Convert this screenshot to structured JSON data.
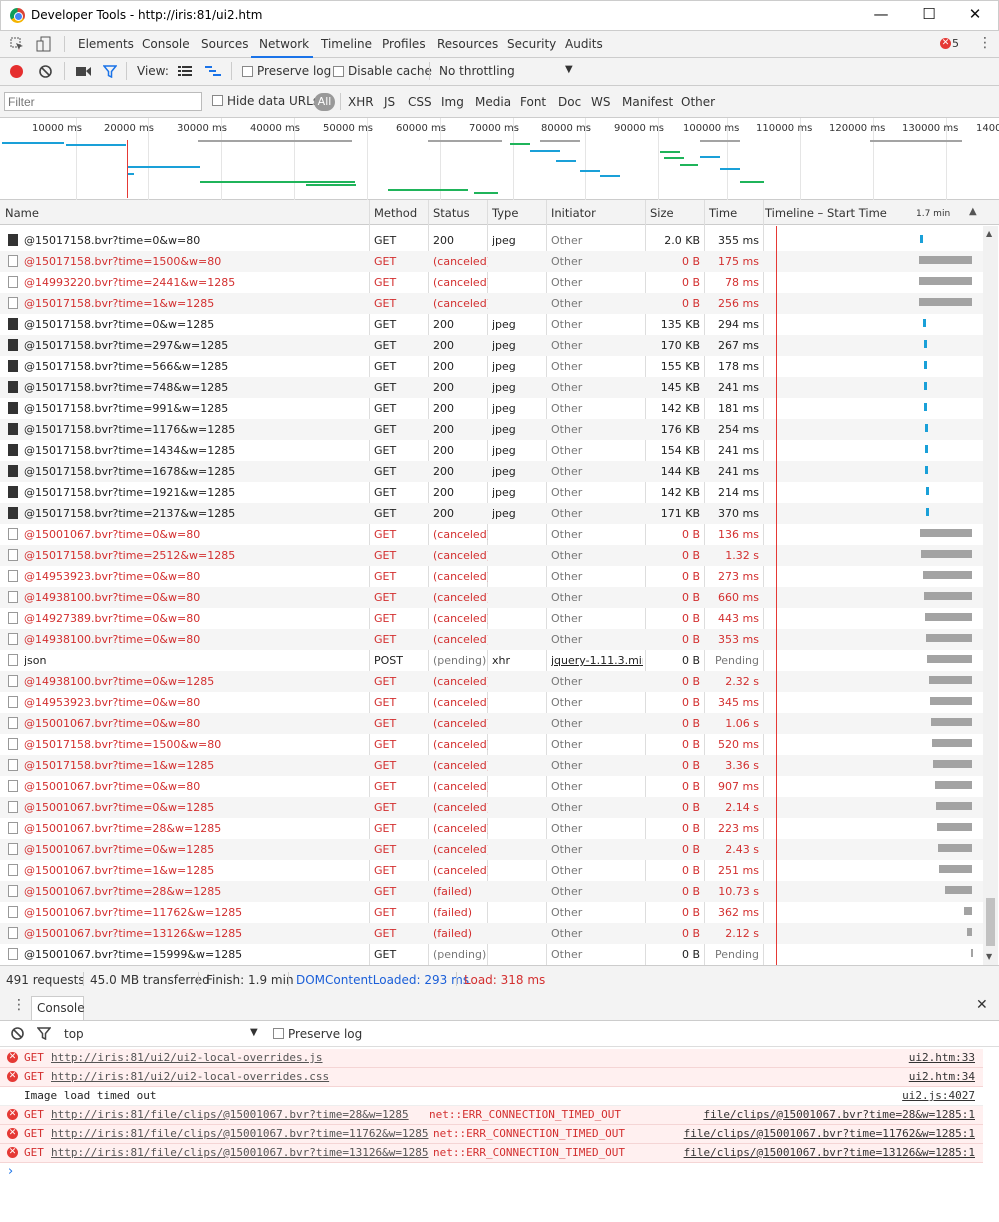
{
  "window": {
    "title": "Developer Tools - http://iris:81/ui2.htm",
    "min": "—",
    "max": "☐",
    "close": "✕"
  },
  "tabs": [
    "Elements",
    "Console",
    "Sources",
    "Network",
    "Timeline",
    "Profiles",
    "Resources",
    "Security",
    "Audits"
  ],
  "error_count": "5",
  "toolbar": {
    "view": "View:",
    "preserve_log": "Preserve log",
    "disable_cache": "Disable cache",
    "throttle": "No throttling"
  },
  "filter": {
    "placeholder": "Filter",
    "hide_data_urls": "Hide data URLs",
    "types": [
      "All",
      "XHR",
      "JS",
      "CSS",
      "Img",
      "Media",
      "Font",
      "Doc",
      "WS",
      "Manifest",
      "Other"
    ]
  },
  "overview": {
    "ticks": [
      "10000 ms",
      "20000 ms",
      "30000 ms",
      "40000 ms",
      "50000 ms",
      "60000 ms",
      "70000 ms",
      "80000 ms",
      "90000 ms",
      "100000 ms",
      "110000 ms",
      "120000 ms",
      "130000 ms",
      "1400"
    ]
  },
  "columns": {
    "name": "Name",
    "method": "Method",
    "status": "Status",
    "type": "Type",
    "initiator": "Initiator",
    "size": "Size",
    "time": "Time",
    "timeline": "Timeline – Start Time",
    "scale": "1.7 min"
  },
  "requests": [
    {
      "name": "@15017158.bvr?time=0&w=80",
      "method": "GET",
      "status": "200",
      "type": "jpeg",
      "initiator": "Other",
      "size": "2.0 KB",
      "time": "355 ms",
      "state": "ok"
    },
    {
      "name": "@15017158.bvr?time=1500&w=80",
      "method": "GET",
      "status": "(canceled)",
      "type": "",
      "initiator": "Other",
      "size": "0 B",
      "time": "175 ms",
      "state": "err"
    },
    {
      "name": "@14993220.bvr?time=2441&w=1285",
      "method": "GET",
      "status": "(canceled)",
      "type": "",
      "initiator": "Other",
      "size": "0 B",
      "time": "78 ms",
      "state": "err"
    },
    {
      "name": "@15017158.bvr?time=1&w=1285",
      "method": "GET",
      "status": "(canceled)",
      "type": "",
      "initiator": "Other",
      "size": "0 B",
      "time": "256 ms",
      "state": "err"
    },
    {
      "name": "@15017158.bvr?time=0&w=1285",
      "method": "GET",
      "status": "200",
      "type": "jpeg",
      "initiator": "Other",
      "size": "135 KB",
      "time": "294 ms",
      "state": "ok"
    },
    {
      "name": "@15017158.bvr?time=297&w=1285",
      "method": "GET",
      "status": "200",
      "type": "jpeg",
      "initiator": "Other",
      "size": "170 KB",
      "time": "267 ms",
      "state": "ok"
    },
    {
      "name": "@15017158.bvr?time=566&w=1285",
      "method": "GET",
      "status": "200",
      "type": "jpeg",
      "initiator": "Other",
      "size": "155 KB",
      "time": "178 ms",
      "state": "ok"
    },
    {
      "name": "@15017158.bvr?time=748&w=1285",
      "method": "GET",
      "status": "200",
      "type": "jpeg",
      "initiator": "Other",
      "size": "145 KB",
      "time": "241 ms",
      "state": "ok"
    },
    {
      "name": "@15017158.bvr?time=991&w=1285",
      "method": "GET",
      "status": "200",
      "type": "jpeg",
      "initiator": "Other",
      "size": "142 KB",
      "time": "181 ms",
      "state": "ok"
    },
    {
      "name": "@15017158.bvr?time=1176&w=1285",
      "method": "GET",
      "status": "200",
      "type": "jpeg",
      "initiator": "Other",
      "size": "176 KB",
      "time": "254 ms",
      "state": "ok"
    },
    {
      "name": "@15017158.bvr?time=1434&w=1285",
      "method": "GET",
      "status": "200",
      "type": "jpeg",
      "initiator": "Other",
      "size": "154 KB",
      "time": "241 ms",
      "state": "ok"
    },
    {
      "name": "@15017158.bvr?time=1678&w=1285",
      "method": "GET",
      "status": "200",
      "type": "jpeg",
      "initiator": "Other",
      "size": "144 KB",
      "time": "241 ms",
      "state": "ok"
    },
    {
      "name": "@15017158.bvr?time=1921&w=1285",
      "method": "GET",
      "status": "200",
      "type": "jpeg",
      "initiator": "Other",
      "size": "142 KB",
      "time": "214 ms",
      "state": "ok"
    },
    {
      "name": "@15017158.bvr?time=2137&w=1285",
      "method": "GET",
      "status": "200",
      "type": "jpeg",
      "initiator": "Other",
      "size": "171 KB",
      "time": "370 ms",
      "state": "ok"
    },
    {
      "name": "@15001067.bvr?time=0&w=80",
      "method": "GET",
      "status": "(canceled)",
      "type": "",
      "initiator": "Other",
      "size": "0 B",
      "time": "136 ms",
      "state": "err"
    },
    {
      "name": "@15017158.bvr?time=2512&w=1285",
      "method": "GET",
      "status": "(canceled)",
      "type": "",
      "initiator": "Other",
      "size": "0 B",
      "time": "1.32 s",
      "state": "err"
    },
    {
      "name": "@14953923.bvr?time=0&w=80",
      "method": "GET",
      "status": "(canceled)",
      "type": "",
      "initiator": "Other",
      "size": "0 B",
      "time": "273 ms",
      "state": "err"
    },
    {
      "name": "@14938100.bvr?time=0&w=80",
      "method": "GET",
      "status": "(canceled)",
      "type": "",
      "initiator": "Other",
      "size": "0 B",
      "time": "660 ms",
      "state": "err"
    },
    {
      "name": "@14927389.bvr?time=0&w=80",
      "method": "GET",
      "status": "(canceled)",
      "type": "",
      "initiator": "Other",
      "size": "0 B",
      "time": "443 ms",
      "state": "err"
    },
    {
      "name": "@14938100.bvr?time=0&w=80",
      "method": "GET",
      "status": "(canceled)",
      "type": "",
      "initiator": "Other",
      "size": "0 B",
      "time": "353 ms",
      "state": "err"
    },
    {
      "name": "json",
      "method": "POST",
      "status": "(pending)",
      "type": "xhr",
      "initiator": "jquery-1.11.3.min...",
      "size": "0 B",
      "time": "Pending",
      "state": "pending"
    },
    {
      "name": "@14938100.bvr?time=0&w=1285",
      "method": "GET",
      "status": "(canceled)",
      "type": "",
      "initiator": "Other",
      "size": "0 B",
      "time": "2.32 s",
      "state": "err"
    },
    {
      "name": "@14953923.bvr?time=0&w=80",
      "method": "GET",
      "status": "(canceled)",
      "type": "",
      "initiator": "Other",
      "size": "0 B",
      "time": "345 ms",
      "state": "err"
    },
    {
      "name": "@15001067.bvr?time=0&w=80",
      "method": "GET",
      "status": "(canceled)",
      "type": "",
      "initiator": "Other",
      "size": "0 B",
      "time": "1.06 s",
      "state": "err"
    },
    {
      "name": "@15017158.bvr?time=1500&w=80",
      "method": "GET",
      "status": "(canceled)",
      "type": "",
      "initiator": "Other",
      "size": "0 B",
      "time": "520 ms",
      "state": "err"
    },
    {
      "name": "@15017158.bvr?time=1&w=1285",
      "method": "GET",
      "status": "(canceled)",
      "type": "",
      "initiator": "Other",
      "size": "0 B",
      "time": "3.36 s",
      "state": "err"
    },
    {
      "name": "@15001067.bvr?time=0&w=80",
      "method": "GET",
      "status": "(canceled)",
      "type": "",
      "initiator": "Other",
      "size": "0 B",
      "time": "907 ms",
      "state": "err"
    },
    {
      "name": "@15001067.bvr?time=0&w=1285",
      "method": "GET",
      "status": "(canceled)",
      "type": "",
      "initiator": "Other",
      "size": "0 B",
      "time": "2.14 s",
      "state": "err"
    },
    {
      "name": "@15001067.bvr?time=28&w=1285",
      "method": "GET",
      "status": "(canceled)",
      "type": "",
      "initiator": "Other",
      "size": "0 B",
      "time": "223 ms",
      "state": "err"
    },
    {
      "name": "@15001067.bvr?time=0&w=1285",
      "method": "GET",
      "status": "(canceled)",
      "type": "",
      "initiator": "Other",
      "size": "0 B",
      "time": "2.43 s",
      "state": "err"
    },
    {
      "name": "@15001067.bvr?time=1&w=1285",
      "method": "GET",
      "status": "(canceled)",
      "type": "",
      "initiator": "Other",
      "size": "0 B",
      "time": "251 ms",
      "state": "err"
    },
    {
      "name": "@15001067.bvr?time=28&w=1285",
      "method": "GET",
      "status": "(failed)",
      "type": "",
      "initiator": "Other",
      "size": "0 B",
      "time": "10.73 s",
      "state": "err"
    },
    {
      "name": "@15001067.bvr?time=11762&w=1285",
      "method": "GET",
      "status": "(failed)",
      "type": "",
      "initiator": "Other",
      "size": "0 B",
      "time": "362 ms",
      "state": "err"
    },
    {
      "name": "@15001067.bvr?time=13126&w=1285",
      "method": "GET",
      "status": "(failed)",
      "type": "",
      "initiator": "Other",
      "size": "0 B",
      "time": "2.12 s",
      "state": "err"
    },
    {
      "name": "@15001067.bvr?time=15999&w=1285",
      "method": "GET",
      "status": "(pending)",
      "type": "",
      "initiator": "Other",
      "size": "0 B",
      "time": "Pending",
      "state": "pending"
    }
  ],
  "status_bar": {
    "requests": "491 requests",
    "transferred": "45.0 MB transferred",
    "finish": "Finish: 1.9 min",
    "dcl": "DOMContentLoaded: 293 ms",
    "load": "Load: 318 ms"
  },
  "drawer": {
    "tab": "Console",
    "context": "top",
    "preserve_log": "Preserve log"
  },
  "console": [
    {
      "kind": "err",
      "prefix": "GET",
      "url": "http://iris:81/ui2/ui2-local-overrides.js",
      "extra": "",
      "source": "ui2.htm:33"
    },
    {
      "kind": "err",
      "prefix": "GET",
      "url": "http://iris:81/ui2/ui2-local-overrides.css",
      "extra": "",
      "source": "ui2.htm:34"
    },
    {
      "kind": "plain",
      "prefix": "",
      "url": "",
      "extra": "Image load timed out",
      "source": "ui2.js:4027"
    },
    {
      "kind": "err",
      "prefix": "GET",
      "url": "http://iris:81/file/clips/@15001067.bvr?time=28&w=1285",
      "extra": "net::ERR_CONNECTION_TIMED_OUT",
      "source": "file/clips/@15001067.bvr?time=28&w=1285:1"
    },
    {
      "kind": "err",
      "prefix": "GET",
      "url": "http://iris:81/file/clips/@15001067.bvr?time=11762&w=1285",
      "extra": "net::ERR_CONNECTION_TIMED_OUT",
      "source": "file/clips/@15001067.bvr?time=11762&w=1285:1"
    },
    {
      "kind": "err",
      "prefix": "GET",
      "url": "http://iris:81/file/clips/@15001067.bvr?time=13126&w=1285",
      "extra": "net::ERR_CONNECTION_TIMED_OUT",
      "source": "file/clips/@15001067.bvr?time=13126&w=1285:1"
    }
  ],
  "colors": {
    "accent": "#1a73e8",
    "error": "#d32f2f",
    "blue_bar": "#1aa0d8",
    "green_bar": "#1fb45a",
    "gray_bar": "#a3a3a3",
    "load_line": "#e53935"
  }
}
